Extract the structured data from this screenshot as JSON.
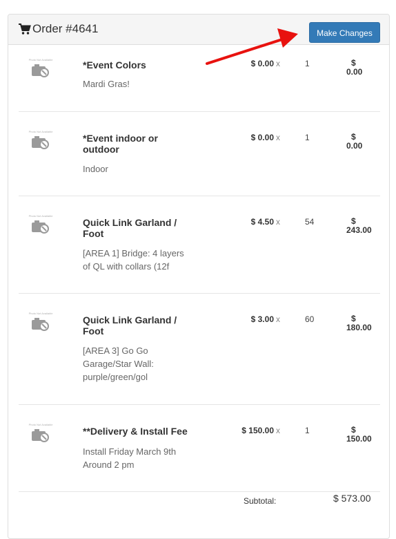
{
  "order": {
    "title": "Order #4641",
    "make_changes_label": "Make Changes"
  },
  "items": [
    {
      "photo_text": "Photo Not Available",
      "name": "*Event Colors",
      "description": "Mardi Gras!",
      "price": "$ 0.00",
      "times": "x",
      "quantity": "1",
      "total_currency": "$",
      "total_value": "0.00"
    },
    {
      "photo_text": "Photo Not Available",
      "name": "*Event indoor or outdoor",
      "description": "Indoor",
      "price": "$ 0.00",
      "times": "x",
      "quantity": "1",
      "total_currency": "$",
      "total_value": "0.00"
    },
    {
      "photo_text": "Photo Not Available",
      "name": "Quick Link Garland / Foot",
      "description": "[AREA 1] Bridge: 4 layers of QL with collars (12f",
      "price": "$ 4.50",
      "times": "x",
      "quantity": "54",
      "total_currency": "$",
      "total_value": "243.00"
    },
    {
      "photo_text": "Photo Not Available",
      "name": "Quick Link Garland / Foot",
      "description": "[AREA 3] Go Go Garage/Star Wall: purple/green/gol",
      "price": "$ 3.00",
      "times": "x",
      "quantity": "60",
      "total_currency": "$",
      "total_value": "180.00"
    },
    {
      "photo_text": "Photo Not Available",
      "name": "**Delivery & Install Fee",
      "description": "Install Friday March 9th Around 2 pm",
      "price": "$ 150.00",
      "times": "x",
      "quantity": "1",
      "total_currency": "$",
      "total_value": "150.00"
    }
  ],
  "summary": {
    "subtotal_label": "Subtotal:",
    "subtotal_value": "$ 573.00"
  },
  "colors": {
    "primary_button": "#337ab7",
    "annotation_arrow": "#e8120f"
  },
  "icons": {
    "cart": "shopping-cart-icon",
    "photo": "camera-placeholder-icon",
    "annotation": "red-arrow-annotation"
  }
}
